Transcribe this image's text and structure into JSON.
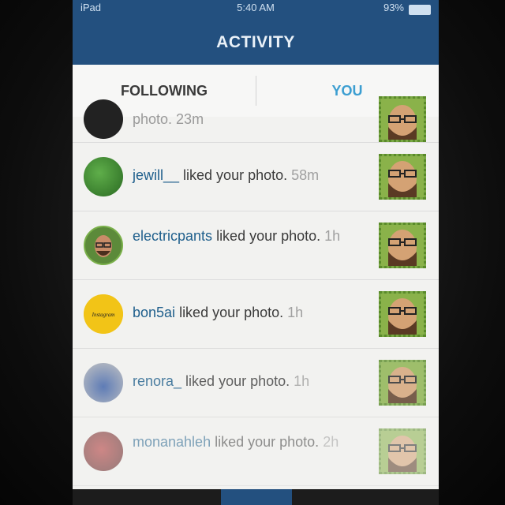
{
  "status": {
    "carrier": "iPad",
    "time": "5:40 AM",
    "battery": "93%"
  },
  "nav": {
    "title": "ACTIVITY"
  },
  "tabs": {
    "following": "FOLLOWING",
    "you": "YOU"
  },
  "partial_row": {
    "text": "photo. 23m"
  },
  "rows": [
    {
      "user": "jewill__",
      "action": " liked your photo.",
      "time": " 58m"
    },
    {
      "user": "electricpants",
      "action": " liked your photo.",
      "time": " 1h"
    },
    {
      "user": "bon5ai",
      "action": " liked your photo.",
      "time": " 1h"
    },
    {
      "user": "renora_",
      "action": " liked your photo.",
      "time": " 1h"
    },
    {
      "user": "monanahleh",
      "action": " liked your photo.",
      "time": " 2h"
    }
  ],
  "avatar_label_bon5ai": "Instagram",
  "colors": {
    "nav": "#23507f",
    "accent": "#3c9ed1",
    "username": "#1f5f8c"
  }
}
